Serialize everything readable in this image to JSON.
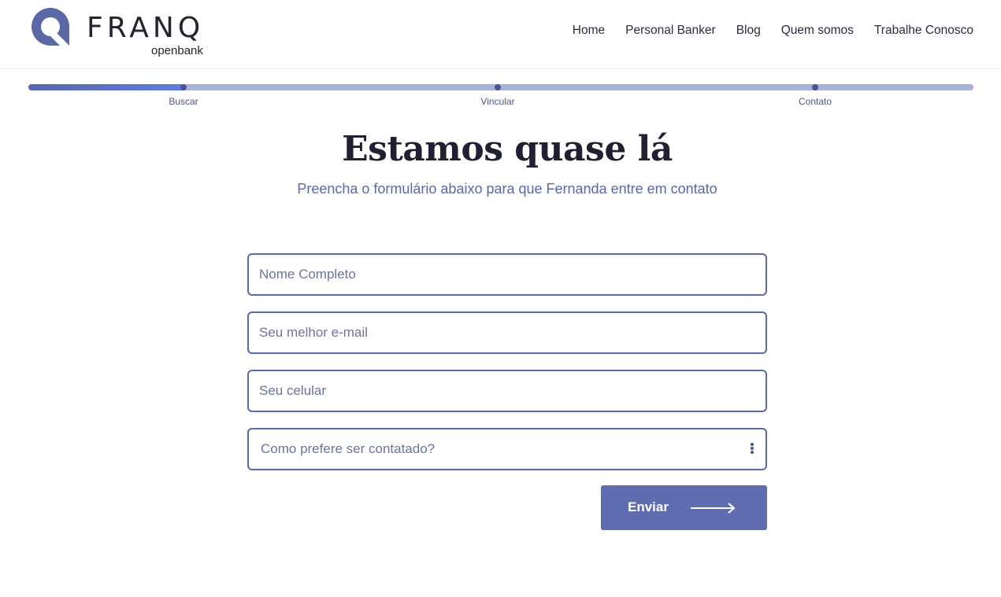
{
  "brand": {
    "name": "FRANQ",
    "tagline": "openbank",
    "accent": "#5b68a6",
    "button": "#5f6db0"
  },
  "nav": {
    "items": [
      {
        "label": "Home"
      },
      {
        "label": "Personal Banker"
      },
      {
        "label": "Blog"
      },
      {
        "label": "Quem somos"
      },
      {
        "label": "Trabalhe Conosco"
      }
    ]
  },
  "progress": {
    "fraction": 0.165,
    "steps": [
      {
        "label": "Buscar"
      },
      {
        "label": "Vincular"
      },
      {
        "label": "Contato"
      }
    ]
  },
  "main": {
    "title": "Estamos quase lá",
    "subtitle": "Preencha o formulário abaixo para que Fernanda entre em contato"
  },
  "form": {
    "name_placeholder": "Nome Completo",
    "email_placeholder": "Seu melhor e-mail",
    "phone_placeholder": "Seu celular",
    "contact_select": "Como prefere ser contatado?",
    "submit_label": "Enviar"
  },
  "icons": {
    "logo": "franq-logo-icon",
    "select_menu": "kebab-icon",
    "submit": "arrow-right-icon"
  }
}
